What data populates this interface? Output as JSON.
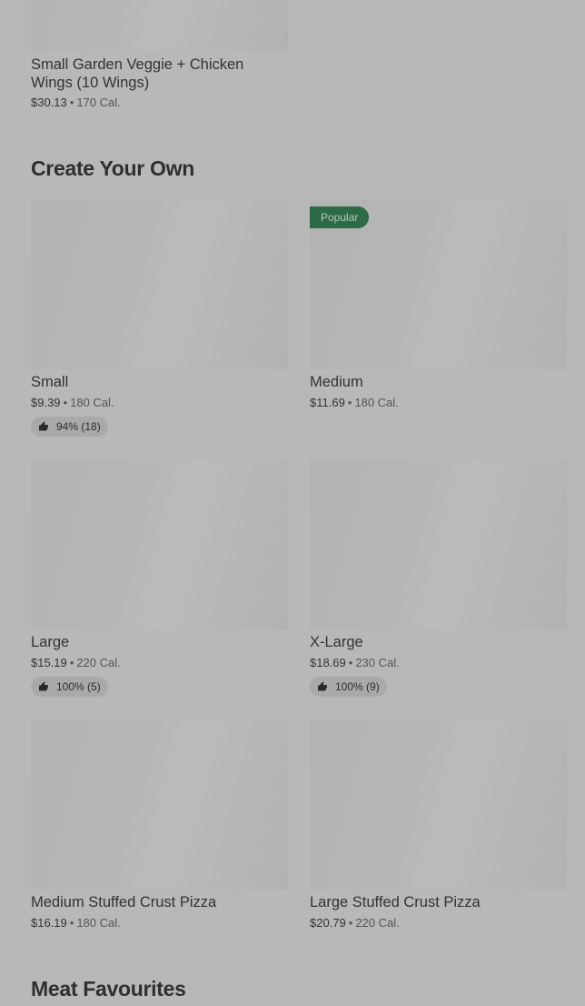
{
  "top_item": {
    "name": "Small Garden Veggie + Chicken Wings (10 Wings)",
    "price": "$30.13",
    "calories": "170 Cal."
  },
  "sections": [
    {
      "title": "Create Your Own",
      "items": [
        {
          "name": "Small",
          "price": "$9.39",
          "calories": "180 Cal.",
          "rating": "94% (18)"
        },
        {
          "name": "Medium",
          "price": "$11.69",
          "calories": "180 Cal.",
          "badge": "Popular"
        },
        {
          "name": "Large",
          "price": "$15.19",
          "calories": "220 Cal.",
          "rating": "100% (5)"
        },
        {
          "name": "X-Large",
          "price": "$18.69",
          "calories": "230 Cal.",
          "rating": "100% (9)"
        },
        {
          "name": "Medium Stuffed Crust Pizza",
          "price": "$16.19",
          "calories": "180 Cal."
        },
        {
          "name": "Large Stuffed Crust Pizza",
          "price": "$20.79",
          "calories": "220 Cal."
        }
      ]
    },
    {
      "title": "Meat Favourites"
    }
  ],
  "separator": "•",
  "icons": {
    "rating": "thumbs-up-icon"
  }
}
